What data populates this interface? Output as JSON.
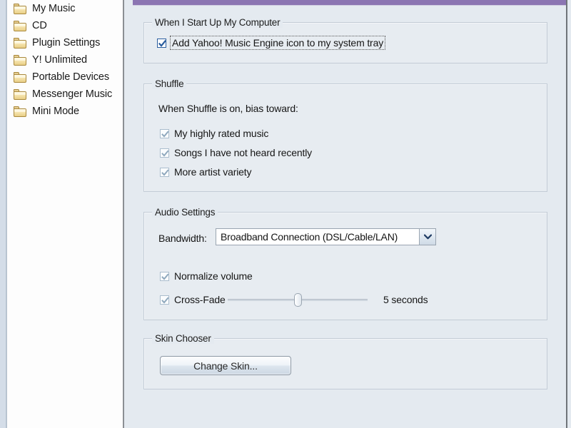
{
  "window": {
    "accent_color": "#8b75b2",
    "background_color": "#e4eaf0"
  },
  "sidebar": {
    "items": [
      {
        "label": "My Music",
        "icon": "folder-icon"
      },
      {
        "label": "CD",
        "icon": "folder-icon"
      },
      {
        "label": "Plugin Settings",
        "icon": "folder-icon"
      },
      {
        "label": "Y! Unlimited",
        "icon": "folder-icon"
      },
      {
        "label": "Portable Devices",
        "icon": "folder-icon"
      },
      {
        "label": "Messenger Music",
        "icon": "folder-icon"
      },
      {
        "label": "Mini Mode",
        "icon": "folder-icon"
      }
    ]
  },
  "groups": {
    "startup": {
      "title": "When I Start Up My Computer",
      "checkbox": {
        "label": "Add Yahoo! Music Engine icon to my system tray",
        "checked": true,
        "focused": true,
        "check_color": "#2a5d9e"
      }
    },
    "shuffle": {
      "title": "Shuffle",
      "description": "When Shuffle is on, bias toward:",
      "checkboxes": [
        {
          "label": "My highly rated music",
          "checked": true
        },
        {
          "label": "Songs I have not heard recently",
          "checked": true
        },
        {
          "label": "More artist variety",
          "checked": true
        }
      ],
      "check_color": "#8fa8bd"
    },
    "audio": {
      "title": "Audio Settings",
      "bandwidth_label": "Bandwidth:",
      "bandwidth_value": "Broadband Connection (DSL/Cable/LAN)",
      "bandwidth_arrow_icon": "chevron-down-icon",
      "normalize": {
        "label": "Normalize volume",
        "checked": true
      },
      "crossfade": {
        "label": "Cross-Fade",
        "checked": true
      },
      "crossfade_slider": {
        "value": 5,
        "min": 0,
        "max": 10,
        "percent": 50,
        "value_text": "5 seconds"
      }
    },
    "skin": {
      "title": "Skin Chooser",
      "button_label": "Change Skin..."
    }
  }
}
